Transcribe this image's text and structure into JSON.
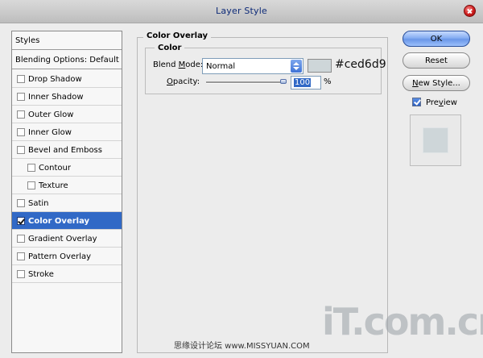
{
  "window": {
    "title": "Layer Style"
  },
  "styles_panel": {
    "header": "Styles",
    "blending_options": "Blending Options: Default",
    "items": [
      {
        "label": "Drop Shadow",
        "checked": false,
        "sub": false,
        "selected": false
      },
      {
        "label": "Inner Shadow",
        "checked": false,
        "sub": false,
        "selected": false
      },
      {
        "label": "Outer Glow",
        "checked": false,
        "sub": false,
        "selected": false
      },
      {
        "label": "Inner Glow",
        "checked": false,
        "sub": false,
        "selected": false
      },
      {
        "label": "Bevel and Emboss",
        "checked": false,
        "sub": false,
        "selected": false
      },
      {
        "label": "Contour",
        "checked": false,
        "sub": true,
        "selected": false
      },
      {
        "label": "Texture",
        "checked": false,
        "sub": true,
        "selected": false
      },
      {
        "label": "Satin",
        "checked": false,
        "sub": false,
        "selected": false
      },
      {
        "label": "Color Overlay",
        "checked": true,
        "sub": false,
        "selected": true
      },
      {
        "label": "Gradient Overlay",
        "checked": false,
        "sub": false,
        "selected": false
      },
      {
        "label": "Pattern Overlay",
        "checked": false,
        "sub": false,
        "selected": false
      },
      {
        "label": "Stroke",
        "checked": false,
        "sub": false,
        "selected": false
      }
    ]
  },
  "main": {
    "group_title": "Color Overlay",
    "color_group_title": "Color",
    "blend_mode_label_pre": "Blend ",
    "blend_mode_label_u": "M",
    "blend_mode_label_post": "ode:",
    "blend_mode_value": "Normal",
    "swatch_color": "#ced6d9",
    "hex_annotation": "#ced6d9",
    "opacity_label_u": "O",
    "opacity_label_post": "pacity:",
    "opacity_value": "100",
    "opacity_unit": "%"
  },
  "buttons": {
    "ok": "OK",
    "reset": "Reset",
    "new_style_u": "N",
    "new_style_rest": "ew Style...",
    "preview_label_pre": "Pre",
    "preview_label_u": "v",
    "preview_label_post": "iew",
    "preview_checked": true
  },
  "watermark": {
    "logo": "iT.com.cn",
    "text": "思缘设计论坛 www.MISSYUAN.COM"
  },
  "colors": {
    "selection": "#3169c6",
    "title_text": "#0d2a78"
  }
}
